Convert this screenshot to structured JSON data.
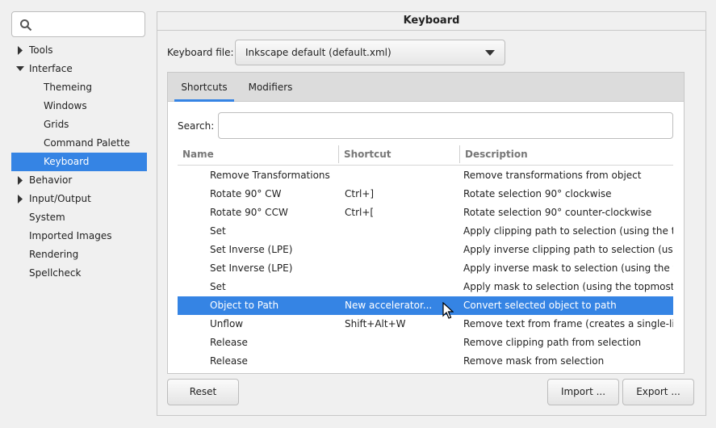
{
  "sidebar": {
    "search_placeholder": "",
    "items": [
      {
        "label": "Tools",
        "expander": "collapsed",
        "level": 0
      },
      {
        "label": "Interface",
        "expander": "expanded",
        "level": 0
      },
      {
        "label": "Themeing",
        "expander": "none",
        "level": 1
      },
      {
        "label": "Windows",
        "expander": "none",
        "level": 1
      },
      {
        "label": "Grids",
        "expander": "none",
        "level": 1
      },
      {
        "label": "Command Palette",
        "expander": "none",
        "level": 1
      },
      {
        "label": "Keyboard",
        "expander": "none",
        "level": 1,
        "selected": true
      },
      {
        "label": "Behavior",
        "expander": "collapsed",
        "level": 0
      },
      {
        "label": "Input/Output",
        "expander": "collapsed",
        "level": 0
      },
      {
        "label": "System",
        "expander": "none",
        "level": 0
      },
      {
        "label": "Imported Images",
        "expander": "none",
        "level": 0
      },
      {
        "label": "Rendering",
        "expander": "none",
        "level": 0
      },
      {
        "label": "Spellcheck",
        "expander": "none",
        "level": 0
      }
    ]
  },
  "main": {
    "title": "Keyboard",
    "keyboard_file_label": "Keyboard file:",
    "keyboard_file_value": "Inkscape default (default.xml)",
    "tabs": [
      {
        "label": "Shortcuts",
        "active": true
      },
      {
        "label": "Modifiers",
        "active": false
      }
    ],
    "search_label": "Search:",
    "search_value": "",
    "columns": {
      "name": "Name",
      "shortcut": "Shortcut",
      "description": "Description"
    },
    "rows": [
      {
        "name": "Remove Transformations",
        "shortcut": "",
        "description": "Remove transformations from object"
      },
      {
        "name": "Rotate 90° CW",
        "shortcut": "Ctrl+]",
        "description": "Rotate selection 90° clockwise"
      },
      {
        "name": "Rotate 90° CCW",
        "shortcut": "Ctrl+[",
        "description": "Rotate selection 90° counter-clockwise"
      },
      {
        "name": "Set",
        "shortcut": "",
        "description": "Apply clipping path to selection (using the topmo"
      },
      {
        "name": "Set Inverse (LPE)",
        "shortcut": "",
        "description": "Apply inverse clipping path to selection (using the"
      },
      {
        "name": "Set Inverse (LPE)",
        "shortcut": "",
        "description": "Apply inverse mask to selection (using the topmos"
      },
      {
        "name": "Set",
        "shortcut": "",
        "description": "Apply mask to selection (using the topmost objec"
      },
      {
        "name": "Object to Path",
        "shortcut": "New accelerator...",
        "description": "Convert selected object to path",
        "selected": true
      },
      {
        "name": "Unflow",
        "shortcut": "Shift+Alt+W",
        "description": "Remove text from frame (creates a single-line text"
      },
      {
        "name": "Release",
        "shortcut": "",
        "description": "Remove clipping path from selection"
      },
      {
        "name": "Release",
        "shortcut": "",
        "description": "Remove mask from selection"
      }
    ],
    "buttons": {
      "reset": "Reset",
      "import": "Import ...",
      "export": "Export ..."
    }
  },
  "colors": {
    "accent": "#3584e4"
  }
}
